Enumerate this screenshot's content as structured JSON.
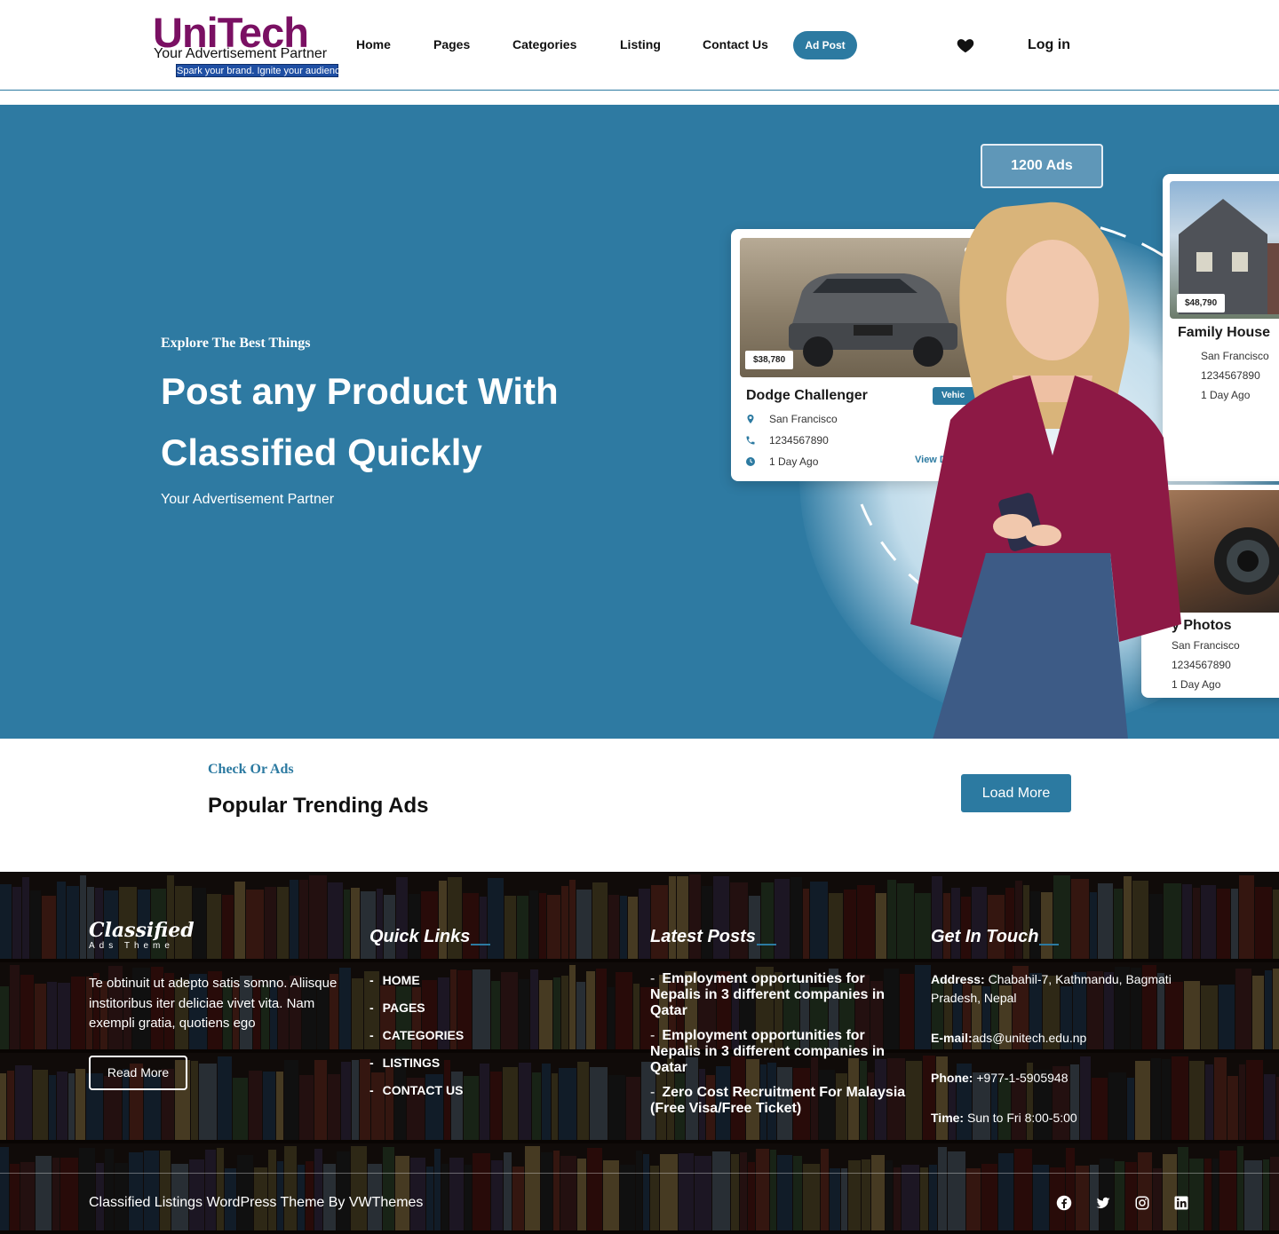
{
  "header": {
    "logo": {
      "name": "UniTech",
      "tagline": "Your Advertisement Partner",
      "slogan": "Spark your brand. Ignite your audience"
    },
    "nav": [
      "Home",
      "Pages",
      "Categories",
      "Listing",
      "Contact Us"
    ],
    "ad_post": "Ad Post",
    "wishlist_icon": "heart-icon",
    "login": "Log in"
  },
  "hero": {
    "eyebrow": "Explore The Best Things",
    "title": "Post any Product With Classified Quickly",
    "subtitle": "Your Advertisement Partner",
    "ads_count": "1200 Ads",
    "cards": [
      {
        "price": "$38,780",
        "title": "Dodge Challenger",
        "category": "Vehic",
        "location": "San Francisco",
        "phone": "1234567890",
        "time": "1 Day Ago",
        "link": "View D"
      },
      {
        "price": "$48,790",
        "title": "Family House",
        "location": "San Francisco",
        "phone": "1234567890",
        "time": "1 Day Ago"
      },
      {
        "title": "y Photos",
        "location": "San Francisco",
        "phone": "1234567890",
        "time": "1 Day Ago"
      }
    ]
  },
  "trending": {
    "eyebrow": "Check Or Ads",
    "title": "Popular Trending Ads",
    "load_more": "Load More"
  },
  "footer": {
    "logo_main": "Classified",
    "logo_sub": "Ads Theme",
    "description": "Te obtinuit ut adepto satis somno. Aliisque institoribus iter deliciae vivet vita. Nam exempli gratia, quotiens ego",
    "read_more": "Read More",
    "quick_links_title": "Quick Links",
    "quick_links": [
      "HOME",
      "PAGES",
      "CATEGORIES",
      "LISTINGS",
      "CONTACT US"
    ],
    "latest_posts_title": "Latest Posts",
    "latest_posts": [
      "Employment opportunities for Nepalis in 3 different companies in Qatar",
      "Employment opportunities for Nepalis in 3 different companies in Qatar",
      "Zero Cost Recruitment For Malaysia (Free Visa/Free Ticket)"
    ],
    "contact_title": "Get In Touch",
    "contact": {
      "address_label": "Address:",
      "address": "Chabahil-7, Kathmandu, Bagmati Pradesh, Nepal",
      "email_label": "E-mail:",
      "email": "ads@unitech.edu.np",
      "phone_label": "Phone:",
      "phone": "+977-1-5905948",
      "time_label": "Time:",
      "time": "Sun to Fri 8:00-5:00"
    },
    "copyright": "Classified Listings WordPress Theme By VWThemes",
    "social": [
      "facebook-icon",
      "twitter-icon",
      "instagram-icon",
      "linkedin-icon"
    ]
  },
  "colors": {
    "primary": "#2c7aa1",
    "logo": "#7a1063",
    "hero_bg": "#2e7aa2",
    "footer_bg": "#1a1412"
  }
}
